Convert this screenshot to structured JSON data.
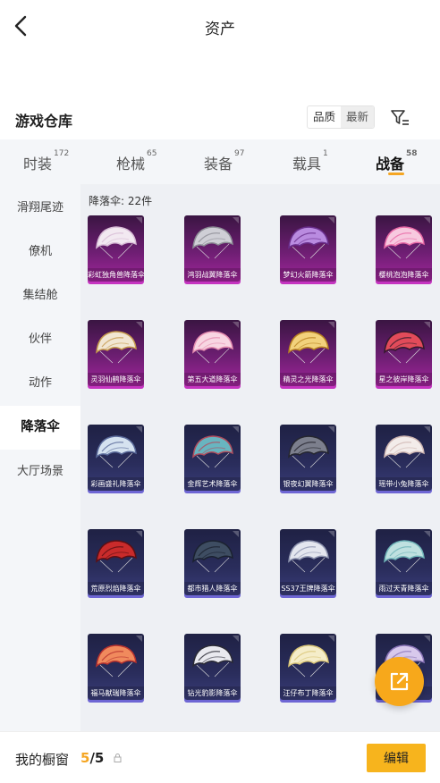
{
  "header": {
    "title": "资产"
  },
  "warehouse": {
    "title": "游戏仓库",
    "sort_options": [
      "品质",
      "最新"
    ],
    "active_sort": 1
  },
  "tabs": [
    {
      "label": "时装",
      "count": "172"
    },
    {
      "label": "枪械",
      "count": "65"
    },
    {
      "label": "装备",
      "count": "97"
    },
    {
      "label": "载具",
      "count": "1"
    },
    {
      "label": "战备",
      "count": "58",
      "active": true
    }
  ],
  "sidebar": {
    "items": [
      "滑翔尾迹",
      "僚机",
      "集结舱",
      "伙伴",
      "动作",
      "降落伞",
      "大厅场景"
    ],
    "active_index": 5
  },
  "content": {
    "count_label": "降落伞: 22件",
    "items": [
      {
        "name": "彩虹独角兽降落伞",
        "rarity": "purple",
        "colors": [
          "#f2e9f1",
          "#d7bcd6"
        ]
      },
      {
        "name": "鸿羽战翼降落伞",
        "rarity": "purple",
        "colors": [
          "#cfcfd6",
          "#8d8d96"
        ]
      },
      {
        "name": "梦幻火箭降落伞",
        "rarity": "purple",
        "colors": [
          "#b98be0",
          "#6a2f8d"
        ]
      },
      {
        "name": "樱桃泡泡降落伞",
        "rarity": "purple",
        "colors": [
          "#f7c9df",
          "#e86aa6"
        ]
      },
      {
        "name": "灵羽仙鹤降落伞",
        "rarity": "purple",
        "colors": [
          "#f1e6d2",
          "#c59a4c"
        ]
      },
      {
        "name": "第五大道降落伞",
        "rarity": "purple",
        "colors": [
          "#f8d6e2",
          "#e58db0"
        ]
      },
      {
        "name": "精灵之光降落伞",
        "rarity": "purple",
        "colors": [
          "#f2d27c",
          "#b98321"
        ]
      },
      {
        "name": "星之彼岸降落伞",
        "rarity": "purple",
        "colors": [
          "#e24b5a",
          "#341a2c"
        ]
      },
      {
        "name": "彩画盛礼降落伞",
        "rarity": "blue",
        "colors": [
          "#d5e2f0",
          "#5a6a9a"
        ]
      },
      {
        "name": "金辉艺术降落伞",
        "rarity": "blue",
        "colors": [
          "#68b5c0",
          "#b04e5e"
        ]
      },
      {
        "name": "银夜幻翼降落伞",
        "rarity": "blue",
        "colors": [
          "#7c7f8d",
          "#25262f"
        ]
      },
      {
        "name": "瑶带小兔降落伞",
        "rarity": "blue",
        "colors": [
          "#f3ecea",
          "#cfb7b3"
        ]
      },
      {
        "name": "荒原烈焰降落伞",
        "rarity": "blue",
        "colors": [
          "#c92b2b",
          "#5d0f14"
        ]
      },
      {
        "name": "都市猎人降落伞",
        "rarity": "blue",
        "colors": [
          "#3e4d62",
          "#1b2230"
        ]
      },
      {
        "name": "SS37王牌降落伞",
        "rarity": "blue",
        "colors": [
          "#e4e6ef",
          "#8f95b0"
        ]
      },
      {
        "name": "雨过天青降落伞",
        "rarity": "blue",
        "colors": [
          "#bfe1e0",
          "#6fb4b8"
        ]
      },
      {
        "name": "福马献瑞降落伞",
        "rarity": "blue",
        "colors": [
          "#f08a5d",
          "#b8322e"
        ]
      },
      {
        "name": "钻光豹影降落伞",
        "rarity": "blue",
        "colors": [
          "#e9e9ef",
          "#2a2a35"
        ]
      },
      {
        "name": "汪仔布丁降落伞",
        "rarity": "blue",
        "colors": [
          "#f5edc9",
          "#d9c577"
        ]
      },
      {
        "name": "",
        "rarity": "blue",
        "colors": [
          "#d8c9ec",
          "#8a74b8"
        ]
      }
    ]
  },
  "showcase": {
    "label": "我的橱窗",
    "current": "5",
    "total": "/5",
    "edit_label": "编辑"
  },
  "colors": {
    "accent": "#f5a623",
    "purple_rarity": "#c534c0",
    "blue_rarity": "#6e66d4"
  }
}
